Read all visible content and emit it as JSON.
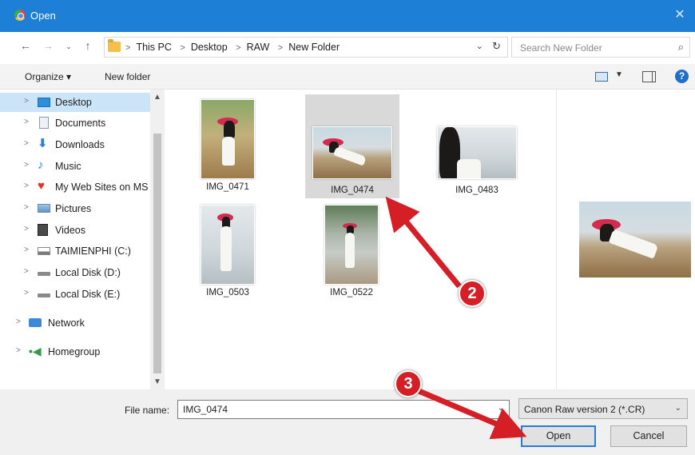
{
  "window": {
    "title": "Open",
    "close_glyph": "✕"
  },
  "address": {
    "crumbs": [
      "This PC",
      "Desktop",
      "RAW",
      "New Folder"
    ],
    "search_placeholder": "Search New Folder"
  },
  "toolbar": {
    "organize_label": "Organize ▾",
    "new_folder_label": "New folder"
  },
  "sidebar": {
    "items": [
      {
        "label": "Desktop",
        "icon": "desktop-icon"
      },
      {
        "label": "Documents",
        "icon": "documents-icon"
      },
      {
        "label": "Downloads",
        "icon": "downloads-icon"
      },
      {
        "label": "Music",
        "icon": "music-icon"
      },
      {
        "label": "My Web Sites on MS",
        "icon": "web-sites-icon"
      },
      {
        "label": "Pictures",
        "icon": "pictures-icon"
      },
      {
        "label": "Videos",
        "icon": "videos-icon"
      },
      {
        "label": "TAIMIENPHI (C:)",
        "icon": "system-drive-icon"
      },
      {
        "label": "Local Disk (D:)",
        "icon": "disk-icon"
      },
      {
        "label": "Local Disk (E:)",
        "icon": "disk-icon"
      },
      {
        "label": "Network",
        "icon": "network-icon"
      },
      {
        "label": "Homegroup",
        "icon": "homegroup-icon"
      }
    ]
  },
  "files": [
    {
      "name": "IMG_0471"
    },
    {
      "name": "IMG_0474"
    },
    {
      "name": "IMG_0483"
    },
    {
      "name": "IMG_0503"
    },
    {
      "name": "IMG_0522"
    }
  ],
  "footer": {
    "file_name_label": "File name:",
    "file_name_value": "IMG_0474",
    "file_type": "Canon Raw version 2 (*.CR)",
    "open_label": "Open",
    "cancel_label": "Cancel"
  },
  "annotations": {
    "marker_2": "2",
    "marker_3": "3"
  },
  "colors": {
    "titlebar": "#1e7fd6",
    "selection": "#cce4f7",
    "annotation": "#d41f27"
  }
}
